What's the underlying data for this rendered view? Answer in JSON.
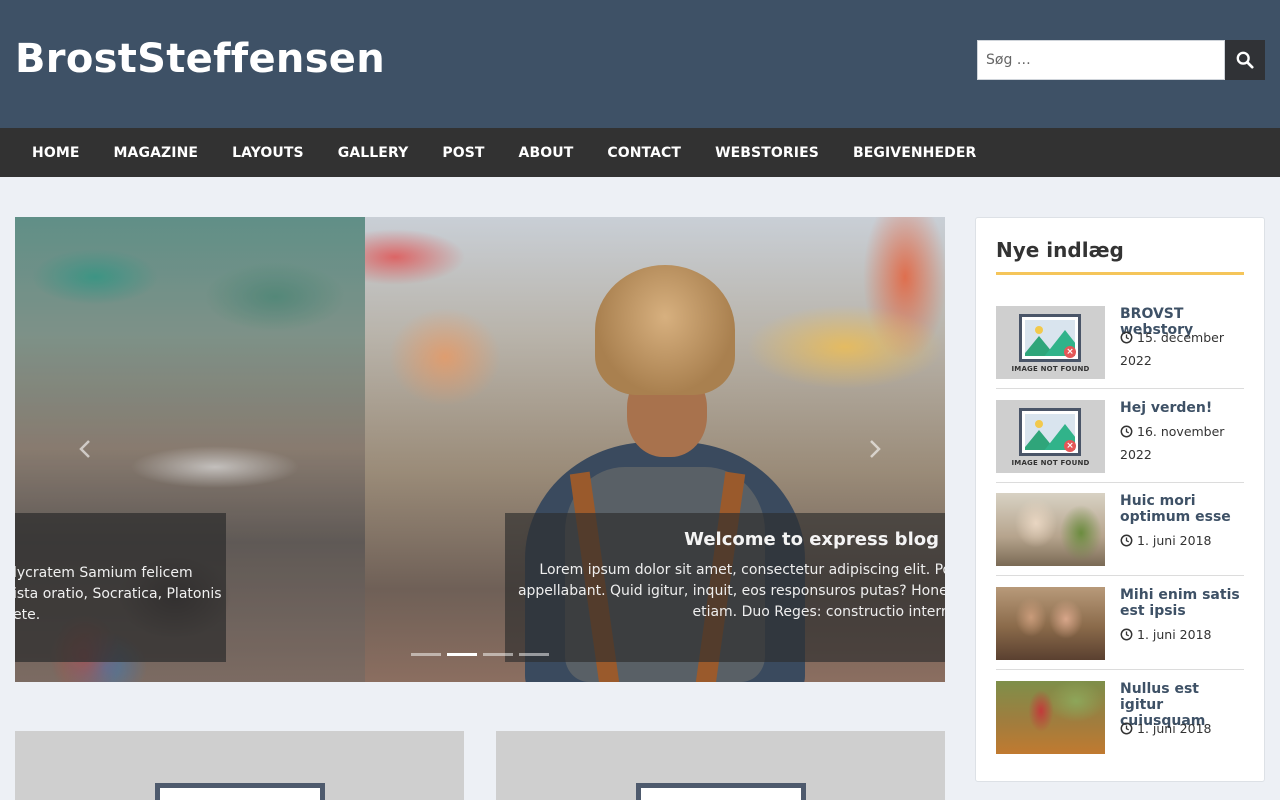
{
  "site": {
    "title": "BrostSteffensen"
  },
  "search": {
    "placeholder": "Søg …"
  },
  "nav": {
    "items": [
      {
        "label": "HOME"
      },
      {
        "label": "MAGAZINE"
      },
      {
        "label": "LAYOUTS"
      },
      {
        "label": "GALLERY"
      },
      {
        "label": "POST"
      },
      {
        "label": "ABOUT"
      },
      {
        "label": "CONTACT"
      },
      {
        "label": "WEBSTORIES"
      },
      {
        "label": "BEGIVENHEDER"
      }
    ]
  },
  "slider": {
    "prev_slide_caption": {
      "lines": [
        "lycratem Samium felicem",
        "ista oratio, Socratica, Platonis",
        "ete."
      ]
    },
    "current_slide": {
      "title": "Welcome to express blog",
      "lines": [
        "Lorem ipsum dolor sit amet, consectetur adipiscing elit. Pol",
        "appellabant. Quid igitur, inquit, eos responsuros putas? Hones",
        "etiam. Duo Reges: constructio interre"
      ]
    },
    "dot_count": 4,
    "active_dot": 1,
    "icons": {
      "prev": "chevron-left-icon",
      "next": "chevron-right-icon"
    }
  },
  "sidebar": {
    "widget_title": "Nye indlæg",
    "posts": [
      {
        "title": "BROVST webstory",
        "date": "15. december 2022",
        "thumb": "image-not-found"
      },
      {
        "title": "Hej verden!",
        "date": "16. november 2022",
        "thumb": "image-not-found"
      },
      {
        "title": "Huic mori optimum esse",
        "date": "1. juni 2018",
        "thumb": "photo-women-table"
      },
      {
        "title": "Mihi enim satis est ipsis",
        "date": "1. juni 2018",
        "thumb": "photo-couple"
      },
      {
        "title": "Nullus est igitur cuiusquam",
        "date": "1. juni 2018",
        "thumb": "photo-runner"
      }
    ],
    "not_found_label": "IMAGE NOT FOUND"
  },
  "colors": {
    "header_bg": "#3e5166",
    "nav_bg": "#323232",
    "accent_underline": "#f5c55a",
    "search_button": "#303236",
    "post_title": "#3e5166"
  }
}
